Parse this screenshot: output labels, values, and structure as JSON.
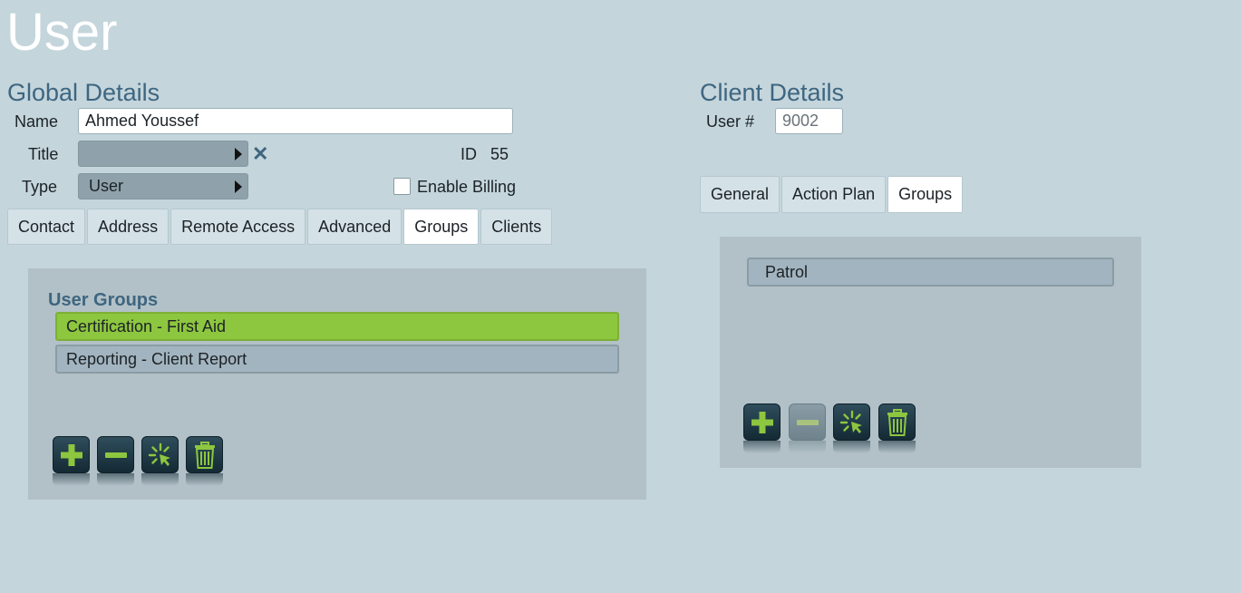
{
  "page": {
    "title": "User"
  },
  "global": {
    "section_title": "Global Details",
    "name_label": "Name",
    "name_value": "Ahmed Youssef",
    "title_label": "Title",
    "title_value": "",
    "id_label": "ID",
    "id_value": "55",
    "type_label": "Type",
    "type_value": "User",
    "billing_label": "Enable Billing",
    "billing_checked": false,
    "tabs": [
      {
        "label": "Contact",
        "active": false
      },
      {
        "label": "Address",
        "active": false
      },
      {
        "label": "Remote Access",
        "active": false
      },
      {
        "label": "Advanced",
        "active": false
      },
      {
        "label": "Groups",
        "active": true
      },
      {
        "label": "Clients",
        "active": false
      }
    ],
    "groups_panel": {
      "title": "User Groups",
      "items": [
        {
          "label": "Certification - First Aid",
          "selected": true
        },
        {
          "label": "Reporting - Client Report",
          "selected": false
        }
      ]
    }
  },
  "client": {
    "section_title": "Client Details",
    "user_no_label": "User #",
    "user_no_value": "9002",
    "tabs": [
      {
        "label": "General",
        "active": false
      },
      {
        "label": "Action Plan",
        "active": false
      },
      {
        "label": "Groups",
        "active": true
      }
    ],
    "groups_panel": {
      "items": [
        {
          "label": "Patrol",
          "selected": false
        }
      ]
    }
  },
  "icons": {
    "clear": "close-icon",
    "add": "plus-icon",
    "remove": "minus-icon",
    "select": "cursor-click-icon",
    "delete": "trash-icon"
  },
  "colors": {
    "background": "#c4d5dc",
    "accent_green": "#8dc63f",
    "heading_blue": "#3e6680",
    "button_dark": "#1e3744"
  }
}
